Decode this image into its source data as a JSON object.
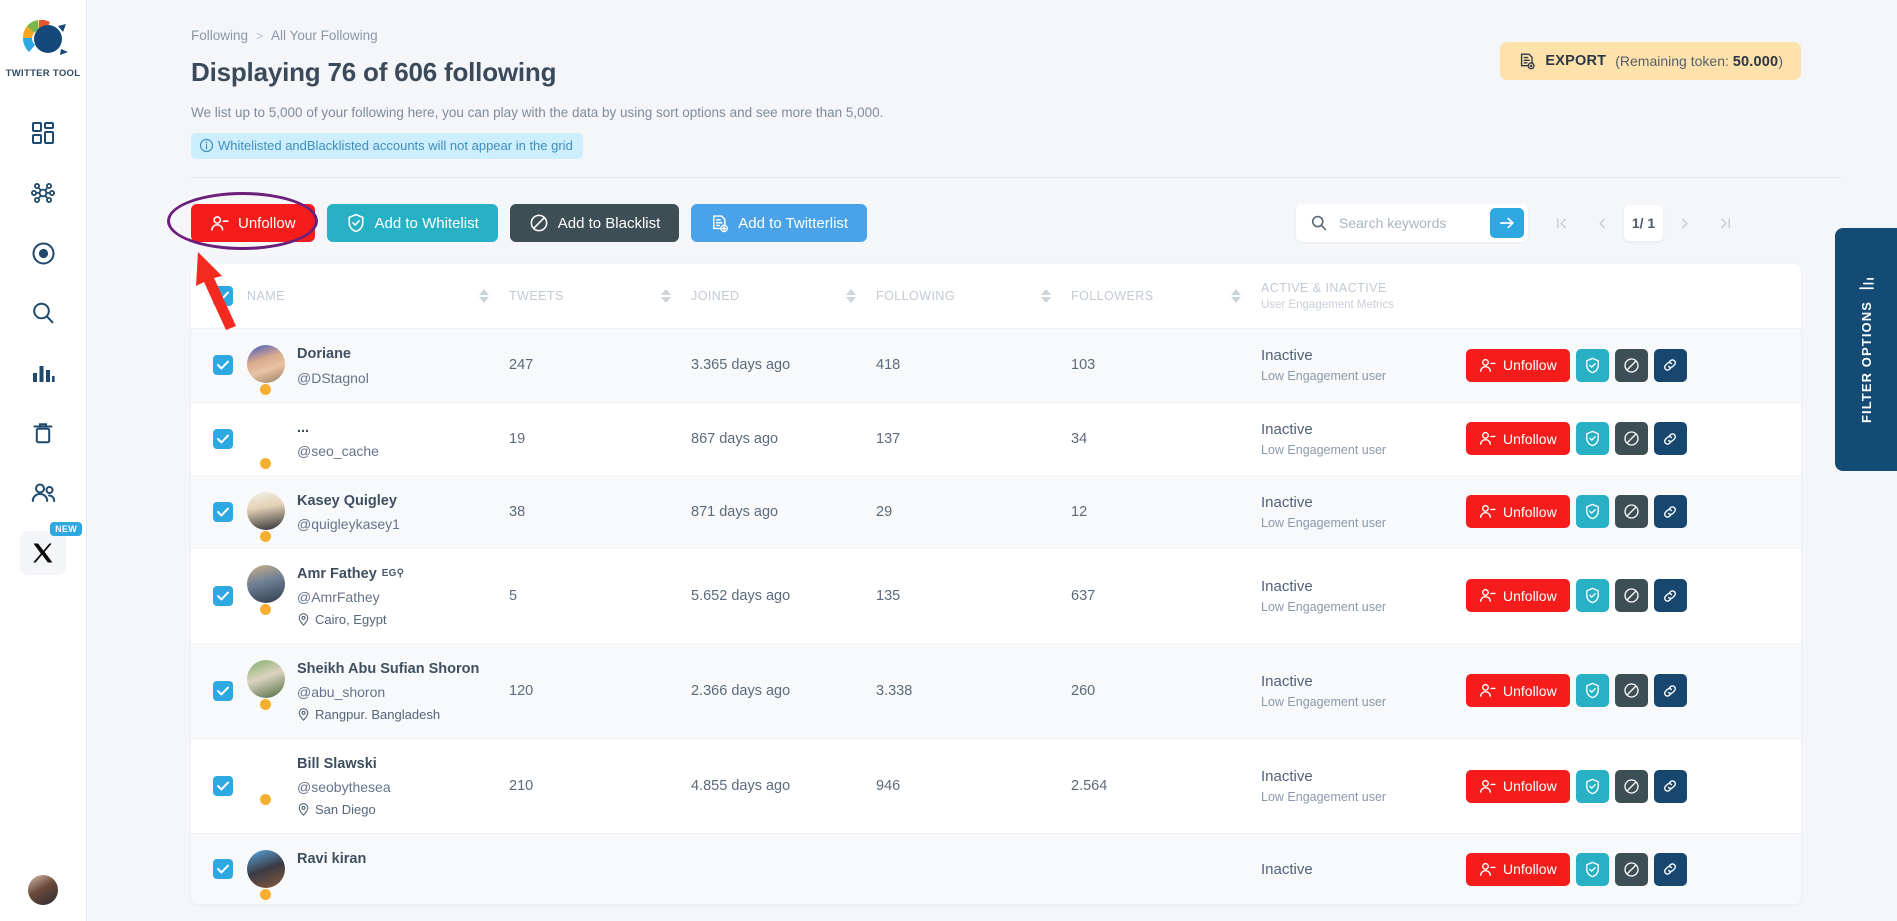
{
  "brand": {
    "name": "TWITTER TOOL",
    "logo_icon": "twitter-tool-logo"
  },
  "sidebar": {
    "items": [
      {
        "name": "dashboard",
        "icon": "dashboard-grid-icon"
      },
      {
        "name": "network",
        "icon": "network-nodes-icon"
      },
      {
        "name": "target",
        "icon": "target-circle-icon"
      },
      {
        "name": "search",
        "icon": "search-icon"
      },
      {
        "name": "analytics",
        "icon": "bar-chart-icon"
      },
      {
        "name": "trash",
        "icon": "trash-icon"
      },
      {
        "name": "audience",
        "icon": "users-icon"
      }
    ],
    "x_item": {
      "icon": "x-logo-icon",
      "badge": "NEW"
    },
    "avatar_icon": "user-avatar"
  },
  "breadcrumb": {
    "parent": "Following",
    "separator": ">",
    "current": "All Your Following"
  },
  "header": {
    "title": "Displaying 76 of 606 following",
    "subtitle": "We list up to 5,000 of your following here, you can play with the data by using sort options and see more than 5,000.",
    "notice": "Whitelisted andBlacklisted accounts will not appear in the grid",
    "notice_icon": "info-circle-icon"
  },
  "export": {
    "icon": "export-file-icon",
    "label": "EXPORT",
    "token_prefix": "(Remaining token: ",
    "token_value": "50.000",
    "token_suffix": ")"
  },
  "bulk_actions": [
    {
      "label": "Unfollow",
      "icon": "user-minus-icon",
      "color": "#f71c1c",
      "style": "red"
    },
    {
      "label": "Add to Whitelist",
      "icon": "shield-check-icon",
      "color": "#28b1c4",
      "style": "teal"
    },
    {
      "label": "Add to Blacklist",
      "icon": "block-icon",
      "color": "#3d4e54",
      "style": "dark"
    },
    {
      "label": "Add to Twitterlist",
      "icon": "list-add-icon",
      "color": "#4aa3e8",
      "style": "blue"
    }
  ],
  "search": {
    "placeholder": "Search keywords",
    "value": "",
    "icon": "search-icon",
    "submit_icon": "arrow-right-icon"
  },
  "pagination": {
    "first_icon": "first-page-icon",
    "prev_icon": "prev-page-icon",
    "current": "1/ 1",
    "next_icon": "next-page-icon",
    "last_icon": "last-page-icon"
  },
  "table": {
    "select_all_checked": true,
    "columns": {
      "name": "NAME",
      "tweets": "TWEETS",
      "joined": "JOINED",
      "following": "FOLLOWING",
      "followers": "FOLLOWERS",
      "engagement": "ACTIVE & INACTIVE",
      "engagement_sub": "User Engagement Metrics"
    },
    "row_actions": {
      "unfollow_label": "Unfollow",
      "unfollow_icon": "user-minus-icon",
      "whitelist_icon": "shield-check-icon",
      "blacklist_icon": "block-icon",
      "link_icon": "link-icon"
    },
    "rows": [
      {
        "checked": true,
        "name": "Doriane",
        "flag": "",
        "handle": "@DStagnol",
        "location": "",
        "tweets": "247",
        "joined": "3.365 days ago",
        "following": "418",
        "followers": "103",
        "status": "Inactive",
        "status_sub": "Low Engagement user",
        "avatar_style": "linear-gradient(160deg,#3b55c8 0%,#d8a98c 38%,#e8c3a4 62%,#9a7b63 100%)"
      },
      {
        "checked": true,
        "name": "...",
        "flag": "",
        "handle": "@seo_cache",
        "location": "",
        "tweets": "19",
        "joined": "867 days ago",
        "following": "137",
        "followers": "34",
        "status": "Inactive",
        "status_sub": "Low Engagement user",
        "avatar_style": "#ffffff"
      },
      {
        "checked": true,
        "name": "Kasey Quigley",
        "flag": "",
        "handle": "@quigleykasey1",
        "location": "",
        "tweets": "38",
        "joined": "871 days ago",
        "following": "29",
        "followers": "12",
        "status": "Inactive",
        "status_sub": "Low Engagement user",
        "avatar_style": "linear-gradient(170deg,#f2efe9 0%,#e4d2b6 40%,#2d2d30 100%)"
      },
      {
        "checked": true,
        "name": "Amr Fathey",
        "flag": "EG⚲",
        "handle": "@AmrFathey",
        "location": "Cairo, Egypt",
        "tweets": "5",
        "joined": "5.652 days ago",
        "following": "135",
        "followers": "637",
        "status": "Inactive",
        "status_sub": "Low Engagement user",
        "avatar_style": "linear-gradient(165deg,#cbb089 0%,#6d7f95 45%,#2f3a4a 100%)"
      },
      {
        "checked": true,
        "name": "Sheikh Abu Sufian Shoron",
        "flag": "",
        "handle": "@abu_shoron",
        "location": "Rangpur. Bangladesh",
        "tweets": "120",
        "joined": "2.366 days ago",
        "following": "3.338",
        "followers": "260",
        "status": "Inactive",
        "status_sub": "Low Engagement user",
        "avatar_style": "linear-gradient(160deg,#7fae6a 0%,#dcd3c0 45%,#4a6b3c 100%)"
      },
      {
        "checked": true,
        "name": "Bill Slawski",
        "flag": "",
        "handle": "@seobythesea",
        "location": "San Diego",
        "tweets": "210",
        "joined": "4.855 days ago",
        "following": "946",
        "followers": "2.564",
        "status": "Inactive",
        "status_sub": "Low Engagement user",
        "avatar_style": "#ffffff"
      },
      {
        "checked": true,
        "name": "Ravi kiran",
        "flag": "",
        "handle": "",
        "location": "",
        "tweets": "",
        "joined": "",
        "following": "",
        "followers": "",
        "status": "Inactive",
        "status_sub": "",
        "avatar_style": "linear-gradient(160deg,#5ba9e0 0%,#3b3b45 50%,#8a5a3c 100%)"
      }
    ]
  },
  "filter_tab": {
    "label": "FILTER OPTIONS",
    "icon": "filter-icon"
  },
  "colors": {
    "accent_blue": "#2ea8e0",
    "danger_red": "#f71c1c",
    "teal": "#28b1c4",
    "dark_slate": "#3d4e54",
    "navy": "#17466f",
    "export_yellow": "#ffe2ab",
    "notice_blue": "#cdeefc",
    "highlight_purple": "#6b1f7a"
  }
}
